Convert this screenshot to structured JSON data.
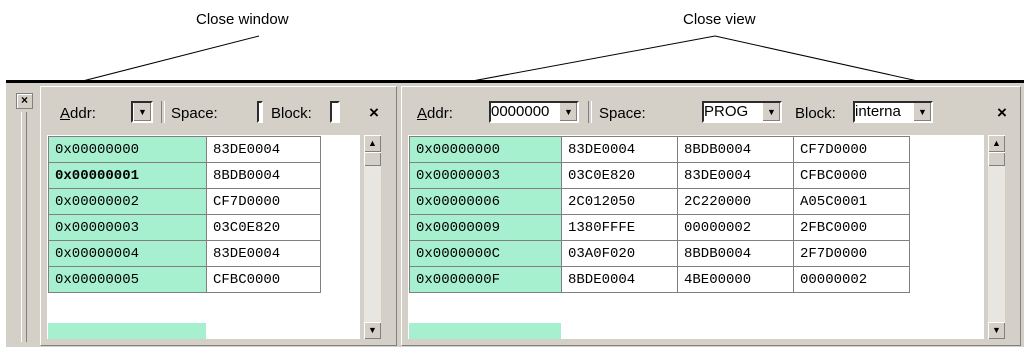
{
  "callouts": {
    "close_window": "Close window",
    "close_view": "Close view"
  },
  "window": {
    "close_glyph": "×"
  },
  "left_view": {
    "addr_label_u": "A",
    "addr_label_rest": "ddr:",
    "addr_value": "",
    "space_label": "Space:",
    "space_value": "",
    "block_label": "Block:",
    "block_value": "",
    "close_glyph": "×",
    "rows": [
      {
        "addr": "0x00000000",
        "val": "83DE0004",
        "bold": false
      },
      {
        "addr": "0x00000001",
        "val": "8BDB0004",
        "bold": true
      },
      {
        "addr": "0x00000002",
        "val": "CF7D0000",
        "bold": false
      },
      {
        "addr": "0x00000003",
        "val": "03C0E820",
        "bold": false
      },
      {
        "addr": "0x00000004",
        "val": "83DE0004",
        "bold": false
      },
      {
        "addr": "0x00000005",
        "val": "CFBC0000",
        "bold": false
      }
    ]
  },
  "right_view": {
    "addr_label_u": "A",
    "addr_label_rest": "ddr:",
    "addr_value": "0000000",
    "space_label": "Space:",
    "space_value": "PROG",
    "block_label": "Block:",
    "block_value": "interna",
    "close_glyph": "×",
    "rows": [
      {
        "addr": "0x00000000",
        "v1": "83DE0004",
        "v2": "8BDB0004",
        "v3": "CF7D0000"
      },
      {
        "addr": "0x00000003",
        "v1": "03C0E820",
        "v2": "83DE0004",
        "v3": "CFBC0000"
      },
      {
        "addr": "0x00000006",
        "v1": "2C012050",
        "v2": "2C220000",
        "v3": "A05C0001"
      },
      {
        "addr": "0x00000009",
        "v1": "1380FFFE",
        "v2": "00000002",
        "v3": "2FBC0000"
      },
      {
        "addr": "0x0000000C",
        "v1": "03A0F020",
        "v2": "8BDB0004",
        "v3": "2F7D0000"
      },
      {
        "addr": "0x0000000F",
        "v1": "8BDE0004",
        "v2": "4BE00000",
        "v3": "00000002"
      }
    ]
  },
  "icons": {
    "dropdown": "chevron-down-icon",
    "scroll_up": "arrow-up-icon",
    "scroll_down": "arrow-down-icon"
  }
}
